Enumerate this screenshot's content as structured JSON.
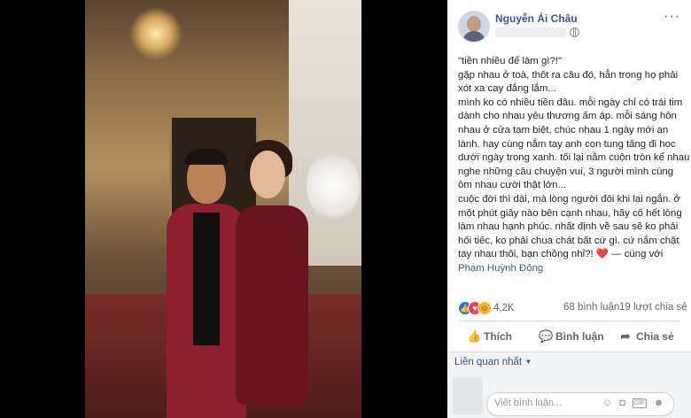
{
  "post": {
    "author": "Nguyễn Ái Châu",
    "text_lines": [
      "\"tiền nhiều để làm gì?!\"",
      "gặp nhau ở toà, thốt ra câu đó, hẳn trong họ phải xót xa cay đắng lắm...",
      "mình ko có nhiều tiền đâu. mỗi ngày chỉ có trái tim dành cho nhau yêu thương ấm áp. mỗi sáng hôn nhau ở cửa tạm biệt, chúc nhau 1 ngày mới an lành. hay cùng nắm tay anh con tung tăng đi học dưới ngày trong xanh. tối lại nằm cuộn tròn kể nhau nghe những câu chuyện vui, 3 người mình cùng ôm nhau cười thật lớn...",
      "cuộc đời thì dài, mà lòng người đôi khi lại ngắn. ở một phút giây nào bên cạnh nhau, hãy cố hết lòng làm nhau hạnh phúc. nhất định về sau sẽ ko phải hối tiếc, ko phải chua chát bất cứ gì. cứ nắm chặt tay nhau thôi, bạn chồng nhỉ?!"
    ],
    "heart": "❤️",
    "with_text": "— cùng với",
    "tagged": "Phạm Huỳnh Đông",
    "reaction_count": "4,2K",
    "comments": "68 bình luận",
    "shares": "19 lượt chia sẻ"
  },
  "actions": {
    "like": "Thích",
    "comment": "Bình luận",
    "share": "Chia sẻ"
  },
  "related": "Liên quan nhất",
  "comment_box": {
    "placeholder": "Viết bình luận..."
  },
  "icons": {
    "more": "more-icon",
    "globe": "globe-icon",
    "like": "thumbs-up-icon",
    "comment": "speech-bubble-icon",
    "share": "share-arrow-icon"
  }
}
